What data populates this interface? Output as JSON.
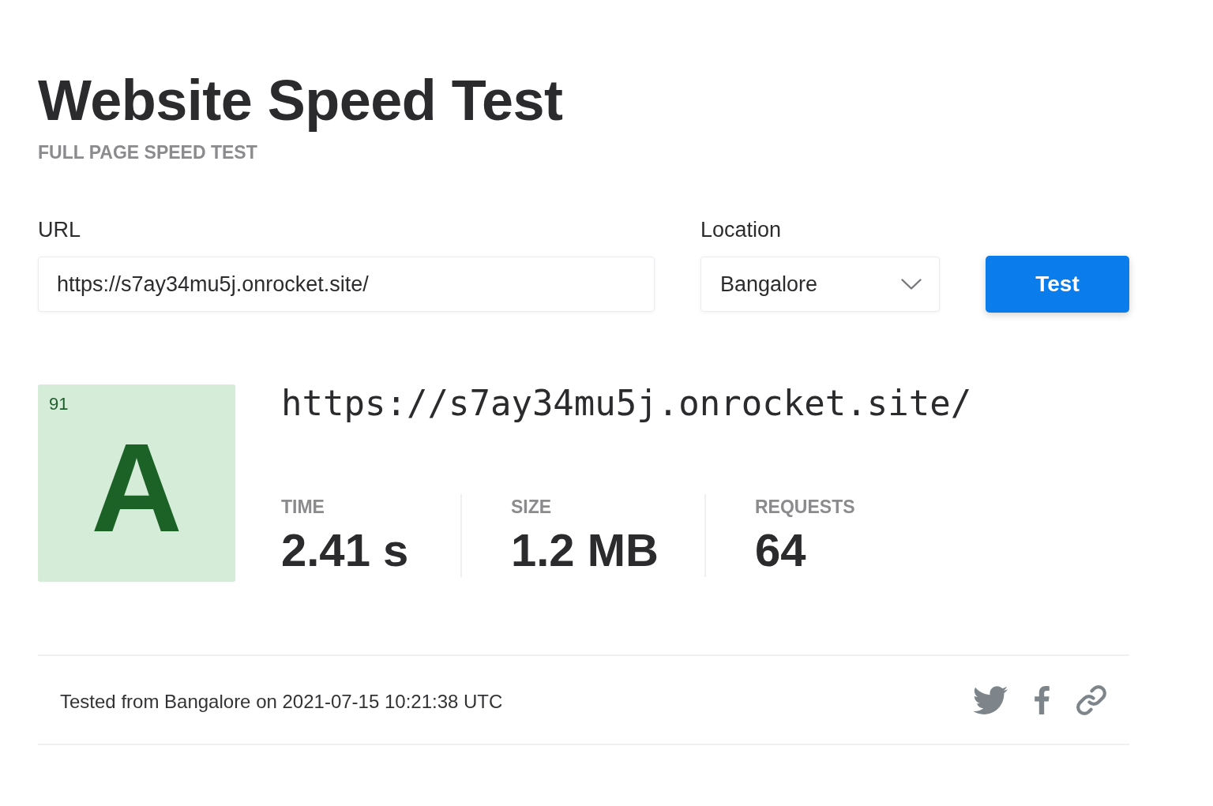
{
  "header": {
    "title": "Website Speed Test",
    "subtitle": "FULL PAGE SPEED TEST"
  },
  "form": {
    "url": {
      "label": "URL",
      "value": "https://s7ay34mu5j.onrocket.site/"
    },
    "location": {
      "label": "Location",
      "value": "Bangalore"
    },
    "button": "Test"
  },
  "result": {
    "score": "91",
    "grade": "A",
    "url": "https://s7ay34mu5j.onrocket.site/",
    "metrics": [
      {
        "label": "TIME",
        "value": "2.41 s"
      },
      {
        "label": "SIZE",
        "value": "1.2 MB"
      },
      {
        "label": "REQUESTS",
        "value": "64"
      }
    ]
  },
  "footer": {
    "text": "Tested from Bangalore on 2021-07-15 10:21:38 UTC"
  }
}
